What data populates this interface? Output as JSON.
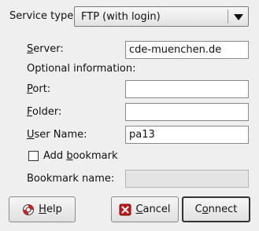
{
  "service_type": {
    "label": "Service type:",
    "selected": "FTP (with login)"
  },
  "server": {
    "label": "Server:",
    "value": "cde-muenchen.de"
  },
  "optional_heading": "Optional information:",
  "port": {
    "label": "Port:",
    "value": ""
  },
  "folder": {
    "label": "Folder:",
    "value": ""
  },
  "user_name": {
    "label": "User Name:",
    "value": "pa13"
  },
  "add_bookmark": {
    "label": "Add bookmark",
    "checked": false
  },
  "bookmark_name": {
    "label": "Bookmark name:",
    "value": ""
  },
  "buttons": {
    "help": "Help",
    "cancel": "Cancel",
    "connect": "Connect"
  },
  "icons": {
    "help": "lifebuoy-icon",
    "cancel": "cancel-x-icon"
  },
  "colors": {
    "cancel_icon": "#c01818",
    "lifebuoy_ring": "#d22020"
  }
}
